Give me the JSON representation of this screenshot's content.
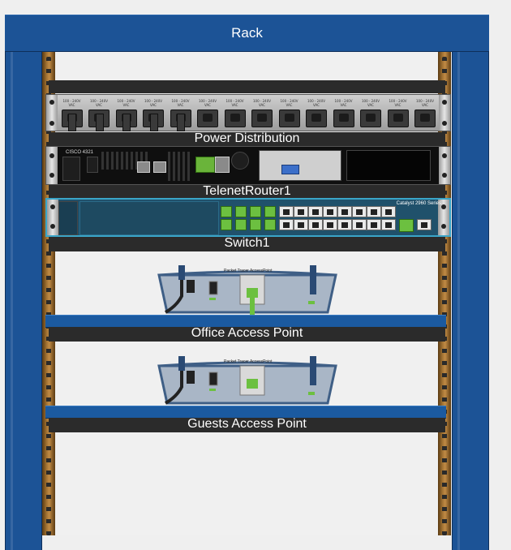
{
  "rack": {
    "title": "Rack"
  },
  "devices": [
    {
      "id": "pdu",
      "label": "Power Distribution"
    },
    {
      "id": "router",
      "label": "TelenetRouter1"
    },
    {
      "id": "switch",
      "label": "Switch1"
    },
    {
      "id": "ap-office",
      "label": "Office Access Point"
    },
    {
      "id": "ap-guests",
      "label": "Guests Access Point"
    }
  ],
  "pdu": {
    "outlet_rating": "100 - 240V VAC\n15\n50/60 Hz",
    "outlet_count": 14,
    "plugged_count": 5
  },
  "router": {
    "model": "CISCO 4321"
  },
  "switch": {
    "model": "Catalyst 2960",
    "series": "Series",
    "port_count": 24,
    "connected_ports": 8
  },
  "access_point": {
    "model": "Packet Tracer AccessPoint"
  },
  "colors": {
    "frame": "#1c5396",
    "label_bar": "#2b2b2b",
    "switch_body": "#20516b",
    "connected": "#6cc040"
  }
}
